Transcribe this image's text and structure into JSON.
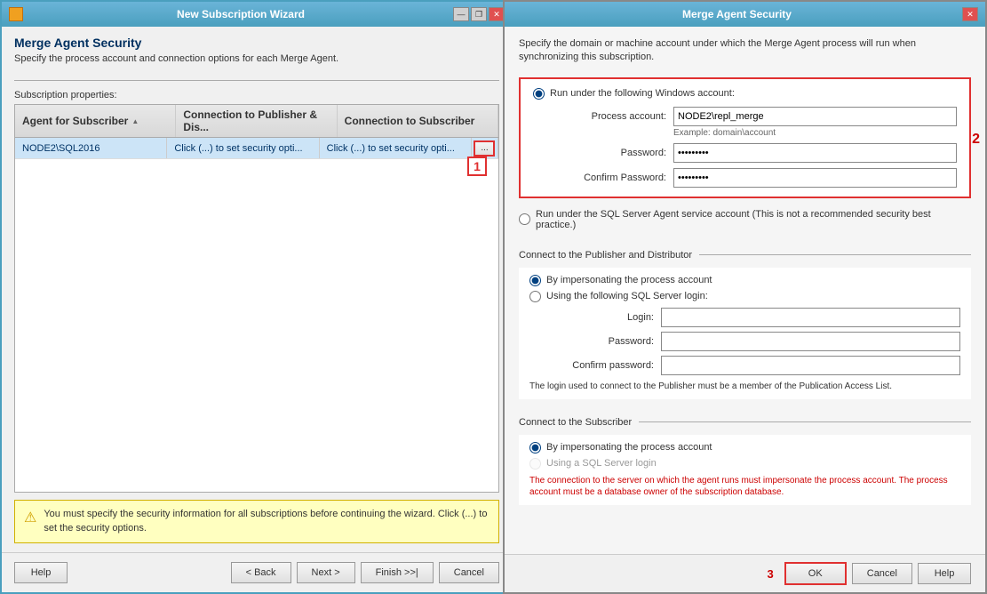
{
  "leftWindow": {
    "title": "New Subscription Wizard",
    "sectionTitle": "Merge Agent Security",
    "sectionSubtitle": "Specify the process account and connection options for each Merge Agent.",
    "subscriptionLabel": "Subscription properties:",
    "tableHeaders": [
      {
        "label": "Agent for Subscriber",
        "sort": true
      },
      {
        "label": "Connection to Publisher & Dis...",
        "sort": false
      },
      {
        "label": "Connection to Subscriber",
        "sort": false
      }
    ],
    "tableRows": [
      {
        "col1": "NODE2\\SQL2016",
        "col2": "Click (...) to set security opti...",
        "col3": "Click (...) to set security opti..."
      }
    ],
    "warningText": "You must specify the security information for all subscriptions before continuing the wizard. Click (...) to set the security options.",
    "buttons": {
      "help": "Help",
      "back": "< Back",
      "next": "Next >",
      "finish": "Finish >>|",
      "cancel": "Cancel"
    },
    "badge1": "1"
  },
  "rightWindow": {
    "title": "Merge Agent Security",
    "descText": "Specify the domain or machine account under which the Merge Agent process will run when synchronizing this subscription.",
    "badge2": "2",
    "badge3": "3",
    "windowsAccountSection": {
      "radio1": "Run under the following Windows account:",
      "processAccountLabel": "Process account:",
      "processAccountValue": "NODE2\\repl_merge",
      "exampleText": "Example: domain\\account",
      "passwordLabel": "Password:",
      "passwordValue": "••••••••",
      "confirmPasswordLabel": "Confirm Password:",
      "confirmPasswordValue": "••••••••|"
    },
    "sqlAgentRadio": "Run under the SQL Server Agent service account (This is not a recommended security best practice.)",
    "publisherSection": {
      "label": "Connect to the Publisher and Distributor",
      "radio1": "By impersonating the process account",
      "radio2": "Using the following SQL Server login:",
      "loginLabel": "Login:",
      "passwordLabel": "Password:",
      "confirmLabel": "Confirm password:",
      "infoText": "The login used to connect to the Publisher must be a member of the Publication Access List."
    },
    "subscriberSection": {
      "label": "Connect to the Subscriber",
      "radio1": "By impersonating the process account",
      "radio2": "Using a SQL Server login",
      "redInfoText": "The connection to the server on which the agent runs must impersonate the process account. The process account must be a database owner of the subscription database."
    },
    "buttons": {
      "ok": "OK",
      "cancel": "Cancel",
      "help": "Help"
    }
  }
}
